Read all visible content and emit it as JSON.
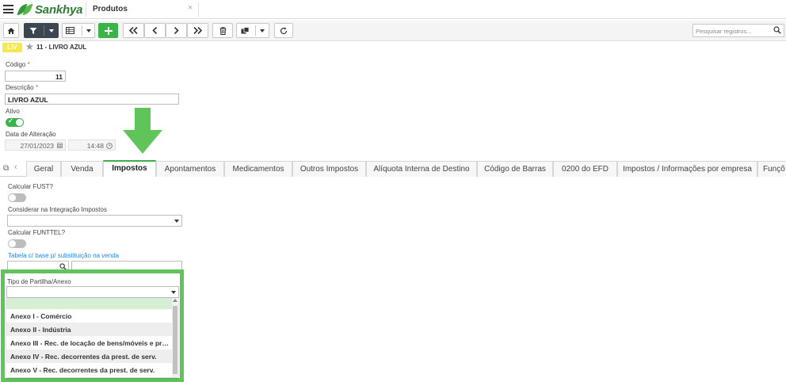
{
  "app": {
    "brand": "Sankhya",
    "tab_title": "Produtos",
    "tab_close": "×"
  },
  "toolbar": {
    "search_placeholder": "Pesquisar registros..."
  },
  "record": {
    "badge": "LIV",
    "title": "11 - LIVRO AZUL"
  },
  "form": {
    "codigo_label": "Código",
    "codigo_value": "11",
    "descricao_label": "Descrição",
    "descricao_value": "LIVRO AZUL",
    "required_mark": "*",
    "ativo_label": "Ativo",
    "ativo_on": true,
    "data_alteracao_label": "Data de Alteração",
    "data_value": "27/01/2023",
    "hora_value": "14:48"
  },
  "tabs": [
    {
      "label": "Geral"
    },
    {
      "label": "Venda"
    },
    {
      "label": "Impostos",
      "active": true
    },
    {
      "label": "Apontamentos"
    },
    {
      "label": "Medicamentos"
    },
    {
      "label": "Outros Impostos"
    },
    {
      "label": "Alíquota Interna de Destino"
    },
    {
      "label": "Código de Barras"
    },
    {
      "label": "0200 do EFD"
    },
    {
      "label": "Impostos / Informações por empresa"
    },
    {
      "label": "Funçõ"
    }
  ],
  "impostos": {
    "calc_fust_label": "Calcular FUST?",
    "considerar_label": "Considerar na Integração Impostos",
    "calc_funttel_label": "Calcular FUNTTEL?",
    "tabela_label": "Tabela c/ base p/ substituição na venda",
    "tipo_partilha_label": "Tipo de Partilha/Anexo",
    "dropdown_options": [
      "",
      "Anexo I - Comércio",
      "Anexo II - Indústria",
      "Anexo III - Rec. de locação de bens/móveis e prest. de serv.",
      "Anexo IV - Rec. decorrentes da prest. de serv.",
      "Anexo V - Rec. decorrentes da prest. de serv."
    ]
  },
  "colors": {
    "accent": "#3cb34a",
    "highlight": "#5fc45a",
    "badge": "#f5e94f",
    "link": "#1e88e5"
  }
}
